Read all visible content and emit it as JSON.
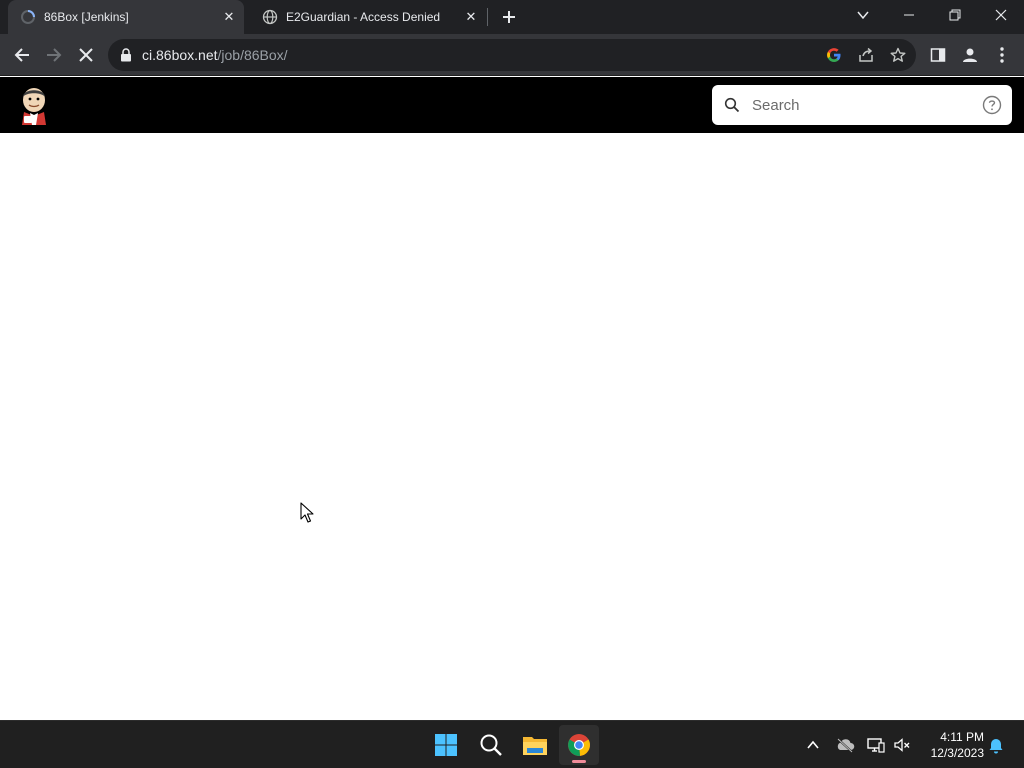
{
  "browser": {
    "tabs": [
      {
        "title": "86Box [Jenkins]",
        "active": true,
        "favicon": "loading-spinner-icon"
      },
      {
        "title": "E2Guardian - Access Denied",
        "active": false,
        "favicon": "globe-icon"
      }
    ],
    "address": {
      "host": "ci.86box.net",
      "path": "/job/86Box/"
    }
  },
  "jenkins": {
    "search_placeholder": "Search"
  },
  "taskbar": {
    "time": "4:11 PM",
    "date": "12/3/2023"
  },
  "colors": {
    "tabstrip_bg": "#202124",
    "toolbar_bg": "#35363a",
    "jenkins_header_bg": "#000000",
    "taskbar_bg": "#202020",
    "chrome_indicator": "#f08c9a"
  }
}
